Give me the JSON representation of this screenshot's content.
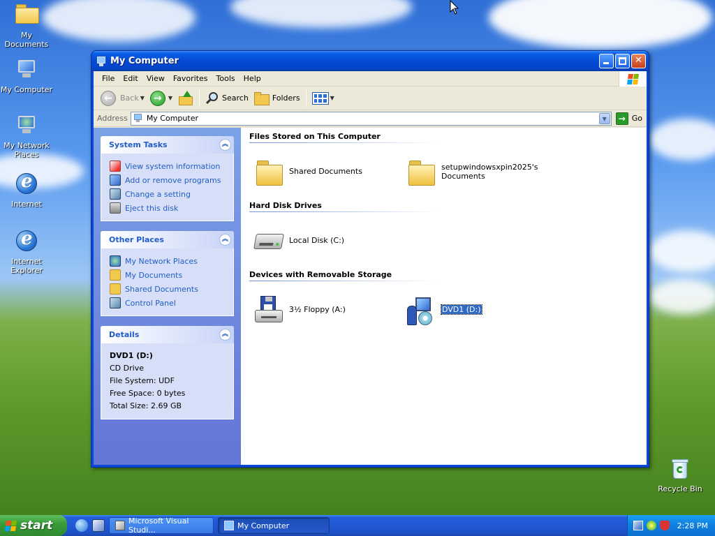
{
  "desktop": {
    "icons": [
      {
        "label": "My Documents"
      },
      {
        "label": "My Computer"
      },
      {
        "label": "My Network Places"
      },
      {
        "label": "Internet"
      },
      {
        "label": "Internet Explorer"
      },
      {
        "label": "Recycle Bin"
      }
    ]
  },
  "window": {
    "title": "My Computer",
    "menu": [
      "File",
      "Edit",
      "View",
      "Favorites",
      "Tools",
      "Help"
    ],
    "toolbar": {
      "back": "Back",
      "search": "Search",
      "folders": "Folders"
    },
    "address": {
      "label": "Address",
      "value": "My Computer",
      "go": "Go"
    },
    "system_tasks": {
      "title": "System Tasks",
      "items": [
        "View system information",
        "Add or remove programs",
        "Change a setting",
        "Eject this disk"
      ]
    },
    "other_places": {
      "title": "Other Places",
      "items": [
        "My Network Places",
        "My Documents",
        "Shared Documents",
        "Control Panel"
      ]
    },
    "details": {
      "title": "Details",
      "name": "DVD1 (D:)",
      "type": "CD Drive",
      "file_system": "File System: UDF",
      "free_space": "Free Space: 0 bytes",
      "total_size": "Total Size: 2.69 GB"
    },
    "groups": {
      "files": {
        "title": "Files Stored on This Computer",
        "items": [
          "Shared Documents",
          "setupwindowsxpin2025's Documents"
        ]
      },
      "hdd": {
        "title": "Hard Disk Drives",
        "items": [
          "Local Disk (C:)"
        ]
      },
      "removable": {
        "title": "Devices with Removable Storage",
        "items": [
          "3½ Floppy (A:)",
          "DVD1 (D:)"
        ]
      }
    }
  },
  "taskbar": {
    "start": "start",
    "tasks": [
      {
        "label": "Microsoft Visual Studi...",
        "active": false
      },
      {
        "label": "My Computer",
        "active": true
      }
    ],
    "clock": "2:28 PM"
  },
  "colors": {
    "titlebar": "#0549d3",
    "taskpane": "#7ba2e7",
    "link": "#215dc6",
    "selection": "#316ac5"
  }
}
